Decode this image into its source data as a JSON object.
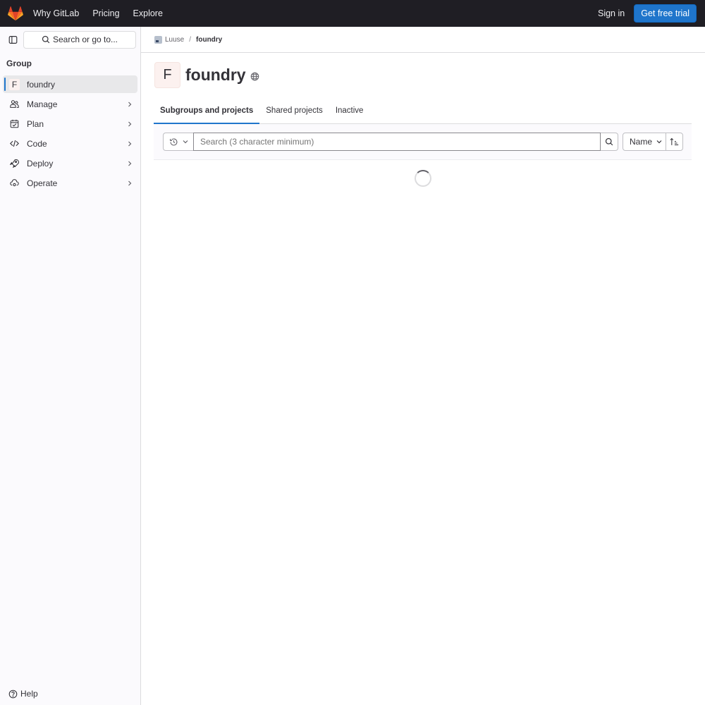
{
  "topbar": {
    "nav": [
      "Why GitLab",
      "Pricing",
      "Explore"
    ],
    "sign_in": "Sign in",
    "trial": "Get free trial"
  },
  "sidebar": {
    "search_label": "Search or go to...",
    "heading": "Group",
    "items": [
      {
        "label": "foundry",
        "icon": "group-avatar",
        "avatar_letter": "F",
        "active": true
      },
      {
        "label": "Manage",
        "icon": "users-icon"
      },
      {
        "label": "Plan",
        "icon": "calendar-icon"
      },
      {
        "label": "Code",
        "icon": "code-icon"
      },
      {
        "label": "Deploy",
        "icon": "rocket-icon"
      },
      {
        "label": "Operate",
        "icon": "cloud-gear-icon"
      }
    ],
    "help": "Help"
  },
  "breadcrumb": {
    "parent": "Luuse",
    "separator": "/",
    "current": "foundry"
  },
  "group": {
    "avatar_letter": "F",
    "title": "foundry",
    "visibility_icon": "globe-icon"
  },
  "tabs": [
    {
      "label": "Subgroups and projects",
      "active": true
    },
    {
      "label": "Shared projects"
    },
    {
      "label": "Inactive"
    }
  ],
  "filter": {
    "placeholder": "Search (3 character minimum)",
    "sort_label": "Name"
  },
  "colors": {
    "accent": "#1f75cb",
    "navbar": "#1f1e24"
  }
}
